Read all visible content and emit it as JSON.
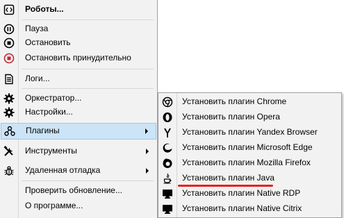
{
  "menu": {
    "items": [
      {
        "label": "Роботы...",
        "icon": "robot-code-icon"
      },
      {
        "label": "Пауза",
        "icon": "pause-icon"
      },
      {
        "label": "Остановить",
        "icon": "stop-icon"
      },
      {
        "label": "Остановить принудительно",
        "icon": "force-stop-icon"
      },
      {
        "label": "Логи...",
        "icon": "document-icon"
      },
      {
        "label": "Оркестратор...",
        "icon": "gear-icon"
      },
      {
        "label": "Настройки...",
        "icon": "gear-icon"
      },
      {
        "label": "Плагины",
        "icon": "plugins-icon"
      },
      {
        "label": "Инструменты",
        "icon": "tools-icon"
      },
      {
        "label": "Удаленная отладка",
        "icon": "bug-icon"
      },
      {
        "label": "Проверить обновление...",
        "icon": ""
      },
      {
        "label": "О программе...",
        "icon": ""
      }
    ]
  },
  "submenu": {
    "items": [
      {
        "label": "Установить плагин Chrome",
        "icon": "chrome-icon"
      },
      {
        "label": "Установить плагин Opera",
        "icon": "opera-icon"
      },
      {
        "label": "Установить плагин Yandex Browser",
        "icon": "yandex-icon"
      },
      {
        "label": "Установить плагин Microsoft Edge",
        "icon": "edge-icon"
      },
      {
        "label": "Установить плагин Mozilla Firefox",
        "icon": "firefox-icon"
      },
      {
        "label": "Установить плагин Java",
        "icon": "java-icon"
      },
      {
        "label": "Установить плагин Native RDP",
        "icon": "monitor-icon"
      },
      {
        "label": "Установить плагин Native Citrix",
        "icon": "monitor-icon"
      }
    ]
  },
  "colors": {
    "highlight": "#cce4f7",
    "highlight_border": "#99c9ef",
    "annotation_underline": "#e8201e",
    "force_stop": "#c0272d"
  }
}
